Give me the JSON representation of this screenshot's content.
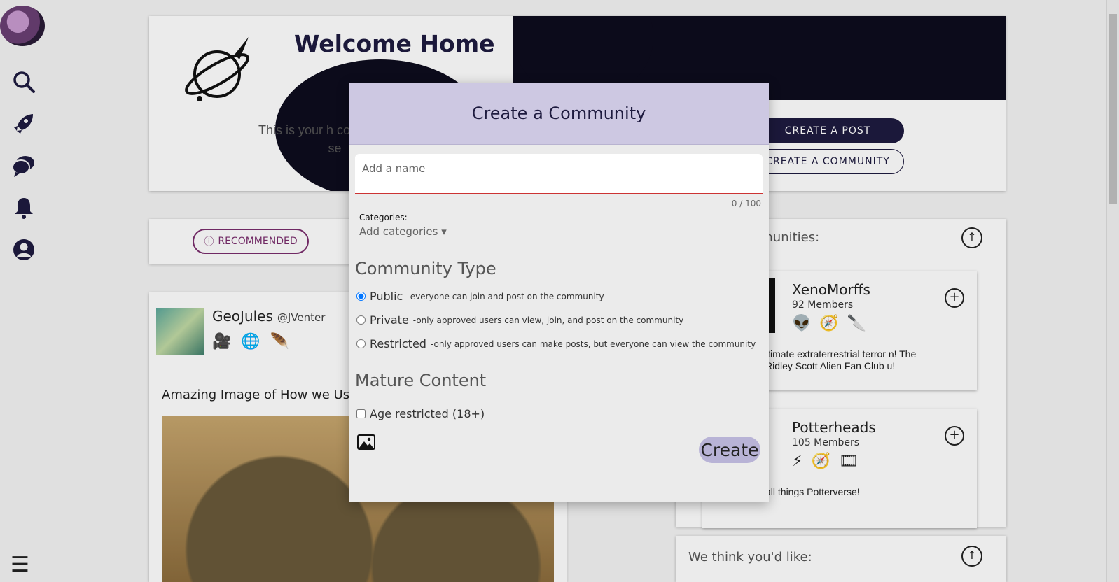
{
  "sidebar": {
    "items": [
      {
        "icon": "search-icon"
      },
      {
        "icon": "rocket-icon"
      },
      {
        "icon": "chat-icon"
      },
      {
        "icon": "bell-icon"
      },
      {
        "icon": "profile-icon"
      }
    ],
    "menu_icon": "hamburger-icon"
  },
  "hero": {
    "title": "Welcome Home",
    "text": "This is your h communities, se",
    "create_post": "CREATE A POST",
    "create_community": "CREATE A COMMUNITY"
  },
  "tabs": {
    "recommended": "RECOMMENDED"
  },
  "post": {
    "user": "GeoJules",
    "handle": "@JVenter",
    "title": "Amazing Image of How we Usec",
    "icons": [
      "🎥",
      "🌐",
      "🪶"
    ]
  },
  "right_col": {
    "title": "ended Communities:",
    "communities": [
      {
        "name": "XenoMorffs",
        "members": "92 Members",
        "description": "ltimate extraterrestrial terror n! The Ridley Scott Alien Fan Club u!",
        "icons": [
          "👽",
          "🧭",
          "🔪"
        ]
      },
      {
        "name": "Potterheads",
        "members": "105 Members",
        "description": "all things Potterverse!",
        "icons": [
          "⚡",
          "🧭",
          "🎞"
        ]
      }
    ],
    "like_title": "We think you'd like:"
  },
  "modal": {
    "title": "Create a Community",
    "name_placeholder": "Add a name",
    "counter": "0 / 100",
    "categories_label": "Categories:",
    "categories_dropdown": "Add categories ▾",
    "community_type_title": "Community Type",
    "types": [
      {
        "label": "Public",
        "desc": "-everyone can join and post on the community",
        "checked": true
      },
      {
        "label": "Private",
        "desc": "-only approved users can view, join, and post on the community",
        "checked": false
      },
      {
        "label": "Restricted",
        "desc": "-only approved users can make posts, but everyone can view the community",
        "checked": false
      }
    ],
    "mature_title": "Mature Content",
    "age_label": "Age restricted (18+)",
    "create_label": "Create"
  },
  "colors": {
    "accent_dark": "#1e1b3f",
    "modal_header": "#cdc8e2",
    "create_button": "#b8b3d6",
    "pill_purple": "#7a2d6d"
  }
}
